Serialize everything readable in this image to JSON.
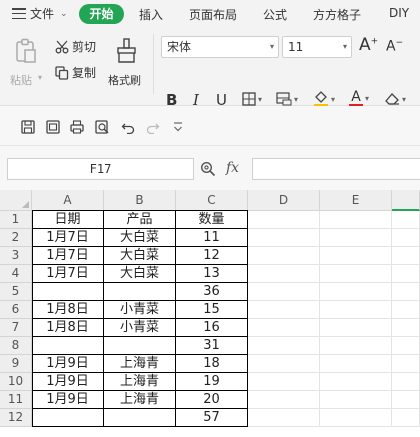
{
  "tabs": {
    "menu_label": "文件",
    "active": "开始",
    "items": [
      "插入",
      "页面布局",
      "公式",
      "方方格子",
      "DIY"
    ]
  },
  "ribbon": {
    "paste_label": "粘贴",
    "cut_label": "剪切",
    "copy_label": "复制",
    "format_painter_label": "格式刷",
    "font_name": "宋体",
    "font_size": "11",
    "bold": "B",
    "italic": "I",
    "underline": "U",
    "font_color_letter": "A",
    "grow_font": "A",
    "shrink_font": "A"
  },
  "formula_bar": {
    "name_box": "F17",
    "fx": "fx",
    "formula": ""
  },
  "grid": {
    "columns": [
      "A",
      "B",
      "C",
      "D",
      "E"
    ],
    "rows": [
      {
        "n": "1",
        "a": "日期",
        "b": "产品",
        "c": "数量"
      },
      {
        "n": "2",
        "a": "1月7日",
        "b": "大白菜",
        "c": "11"
      },
      {
        "n": "3",
        "a": "1月7日",
        "b": "大白菜",
        "c": "12"
      },
      {
        "n": "4",
        "a": "1月7日",
        "b": "大白菜",
        "c": "13"
      },
      {
        "n": "5",
        "a": "",
        "b": "",
        "c": "36"
      },
      {
        "n": "6",
        "a": "1月8日",
        "b": "小青菜",
        "c": "15"
      },
      {
        "n": "7",
        "a": "1月8日",
        "b": "小青菜",
        "c": "16"
      },
      {
        "n": "8",
        "a": "",
        "b": "",
        "c": "31"
      },
      {
        "n": "9",
        "a": "1月9日",
        "b": "上海青",
        "c": "18"
      },
      {
        "n": "10",
        "a": "1月9日",
        "b": "上海青",
        "c": "19"
      },
      {
        "n": "11",
        "a": "1月9日",
        "b": "上海青",
        "c": "20"
      },
      {
        "n": "12",
        "a": "",
        "b": "",
        "c": "57"
      }
    ]
  },
  "colors": {
    "accent": "#22a554",
    "font_color_underline": "#e02020",
    "highlight_underline": "#f5c400"
  }
}
